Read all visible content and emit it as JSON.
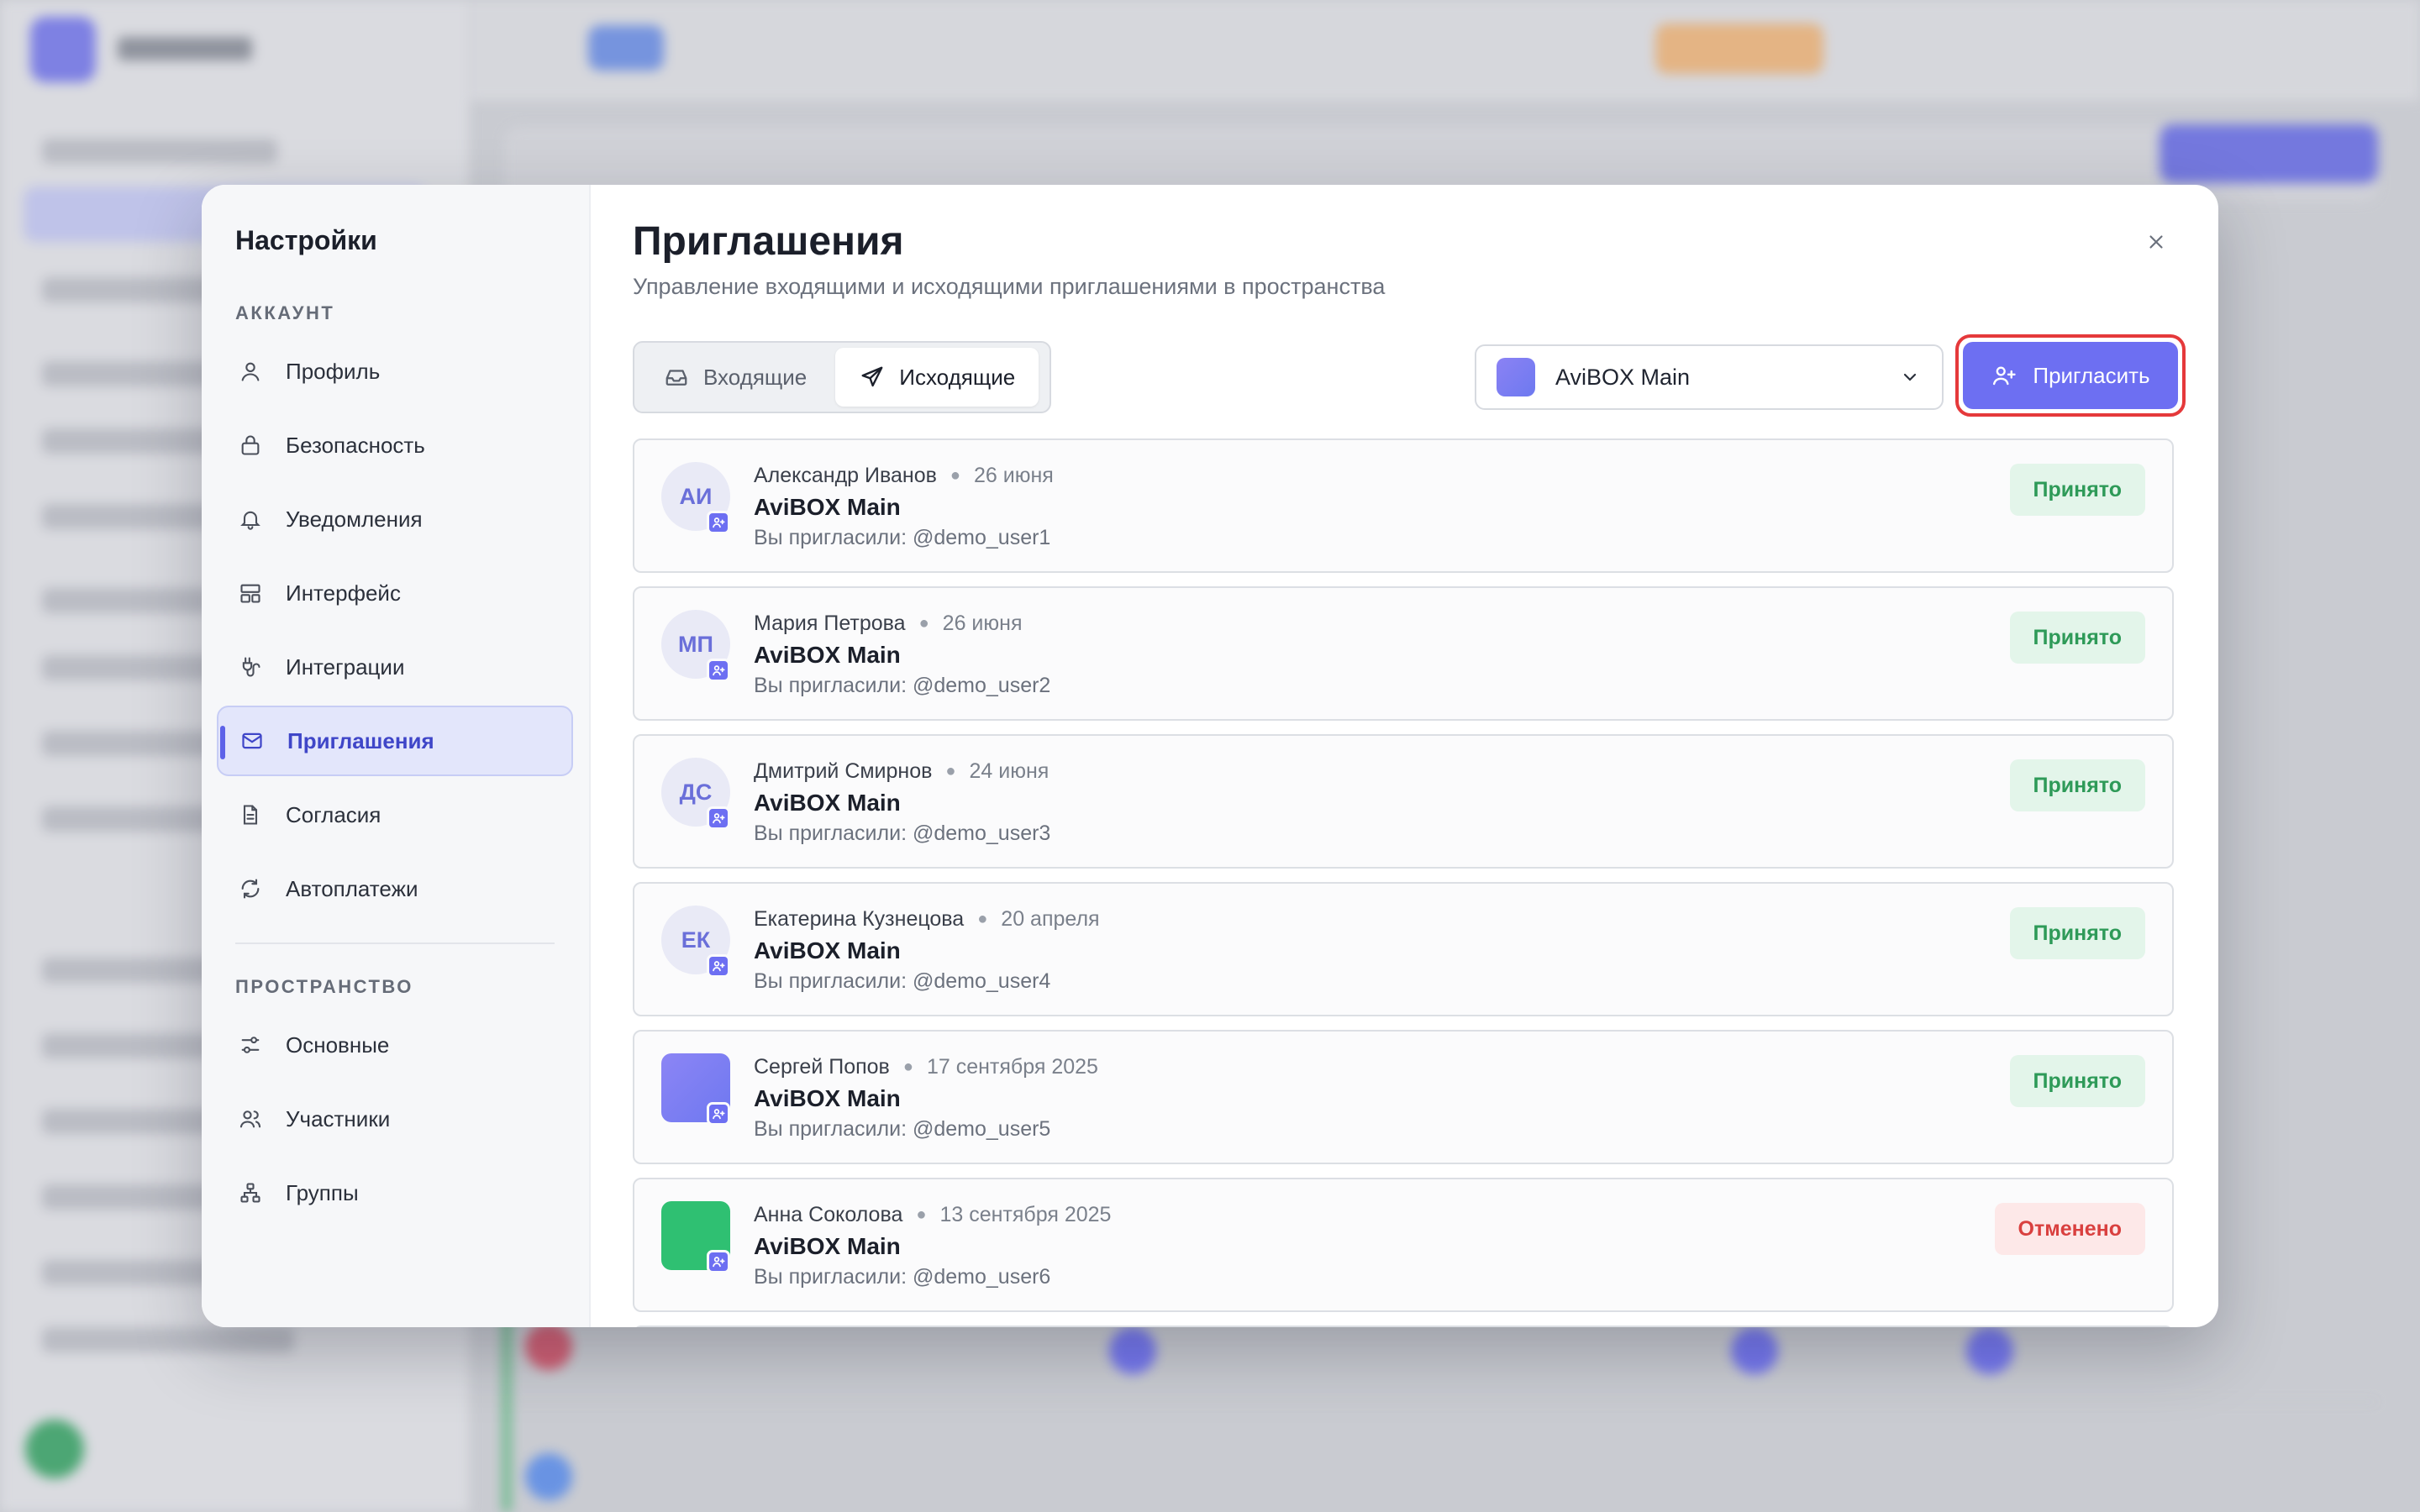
{
  "settings": {
    "title": "Настройки",
    "account_section": "АККАУНТ",
    "space_section": "ПРОСТРАНСТВО",
    "account_items": [
      {
        "label": "Профиль",
        "icon": "user-icon"
      },
      {
        "label": "Безопасность",
        "icon": "lock-icon"
      },
      {
        "label": "Уведомления",
        "icon": "bell-icon"
      },
      {
        "label": "Интерфейс",
        "icon": "layout-icon"
      },
      {
        "label": "Интеграции",
        "icon": "plug-icon"
      },
      {
        "label": "Приглашения",
        "icon": "mail-icon",
        "active": true
      },
      {
        "label": "Согласия",
        "icon": "document-icon"
      },
      {
        "label": "Автоплатежи",
        "icon": "refresh-icon"
      }
    ],
    "space_items": [
      {
        "label": "Основные",
        "icon": "sliders-icon"
      },
      {
        "label": "Участники",
        "icon": "users-icon"
      },
      {
        "label": "Группы",
        "icon": "hierarchy-icon"
      }
    ]
  },
  "page": {
    "title": "Приглашения",
    "subtitle": "Управление входящими и исходящими приглашениями в пространства"
  },
  "tabs": [
    {
      "label": "Входящие",
      "icon": "inbox-icon",
      "active": false
    },
    {
      "label": "Исходящие",
      "icon": "send-icon",
      "active": true
    }
  ],
  "workspace_select": {
    "value": "AviBOX Main"
  },
  "invite_button": {
    "label": "Пригласить"
  },
  "invitations": [
    {
      "initials": "АИ",
      "name": "Александр Иванов",
      "date": "26 июня",
      "space": "AviBOX Main",
      "invited": "Вы пригласили: @demo_user1",
      "status": "Принято",
      "status_type": "ok"
    },
    {
      "initials": "МП",
      "name": "Мария Петрова",
      "date": "26 июня",
      "space": "AviBOX Main",
      "invited": "Вы пригласили: @demo_user2",
      "status": "Принято",
      "status_type": "ok"
    },
    {
      "initials": "ДС",
      "name": "Дмитрий Смирнов",
      "date": "24 июня",
      "space": "AviBOX Main",
      "invited": "Вы пригласили: @demo_user3",
      "status": "Принято",
      "status_type": "ok"
    },
    {
      "initials": "ЕК",
      "name": "Екатерина Кузнецова",
      "date": "20 апреля",
      "space": "AviBOX Main",
      "invited": "Вы пригласили: @demo_user4",
      "status": "Принято",
      "status_type": "ok"
    },
    {
      "initials": "",
      "avatar_color": "#7b7ff0",
      "name": "Сергей Попов",
      "date": "17 сентября 2025",
      "space": "AviBOX Main",
      "invited": "Вы пригласили: @demo_user5",
      "status": "Принято",
      "status_type": "ok"
    },
    {
      "initials": "",
      "avatar_color": "#2fc072",
      "name": "Анна Соколова",
      "date": "13 сентября 2025",
      "space": "AviBOX Main",
      "invited": "Вы пригласили: @demo_user6",
      "status": "Отменено",
      "status_type": "cancel"
    }
  ],
  "colors": {
    "accent": "#6d6ff2",
    "highlight": "#e5393b",
    "accepted": "#2e9a58",
    "cancelled": "#d9403f"
  }
}
